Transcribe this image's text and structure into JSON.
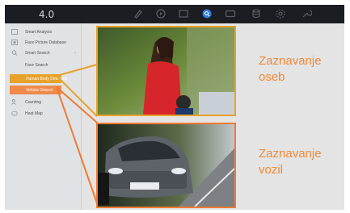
{
  "app": {
    "version": "4.0"
  },
  "toolbar_icons": [
    "search-icon",
    "playback-icon",
    "folder-icon",
    "smart-analysis-icon",
    "screen-icon",
    "storage-icon",
    "settings-icon",
    "maintenance-icon"
  ],
  "sidebar": {
    "items": [
      {
        "label": "Smart Analysis",
        "icon": "chart-icon"
      },
      {
        "label": "Face Picture Database",
        "icon": "face-db-icon"
      },
      {
        "label": "Smart Search",
        "icon": "magnifier-icon"
      },
      {
        "label": "Face Search"
      },
      {
        "label": "Human Body Detection"
      },
      {
        "label": "Vehicle Search"
      },
      {
        "label": "Counting",
        "icon": "people-icon"
      },
      {
        "label": "Heat Map",
        "icon": "heat-icon"
      }
    ]
  },
  "captions": {
    "person": {
      "line1": "Zaznavanje",
      "line2": "oseb"
    },
    "vehicle": {
      "line1": "Zaznavanje",
      "line2": "vozil"
    }
  },
  "colors": {
    "accent_yellow": "#e8a22a",
    "accent_orange": "#ef7b32",
    "caption": "#ef8a3a",
    "topbar": "#1b1d22",
    "sidebar": "#dfe3e6",
    "active_icon": "#2f7fe0"
  }
}
